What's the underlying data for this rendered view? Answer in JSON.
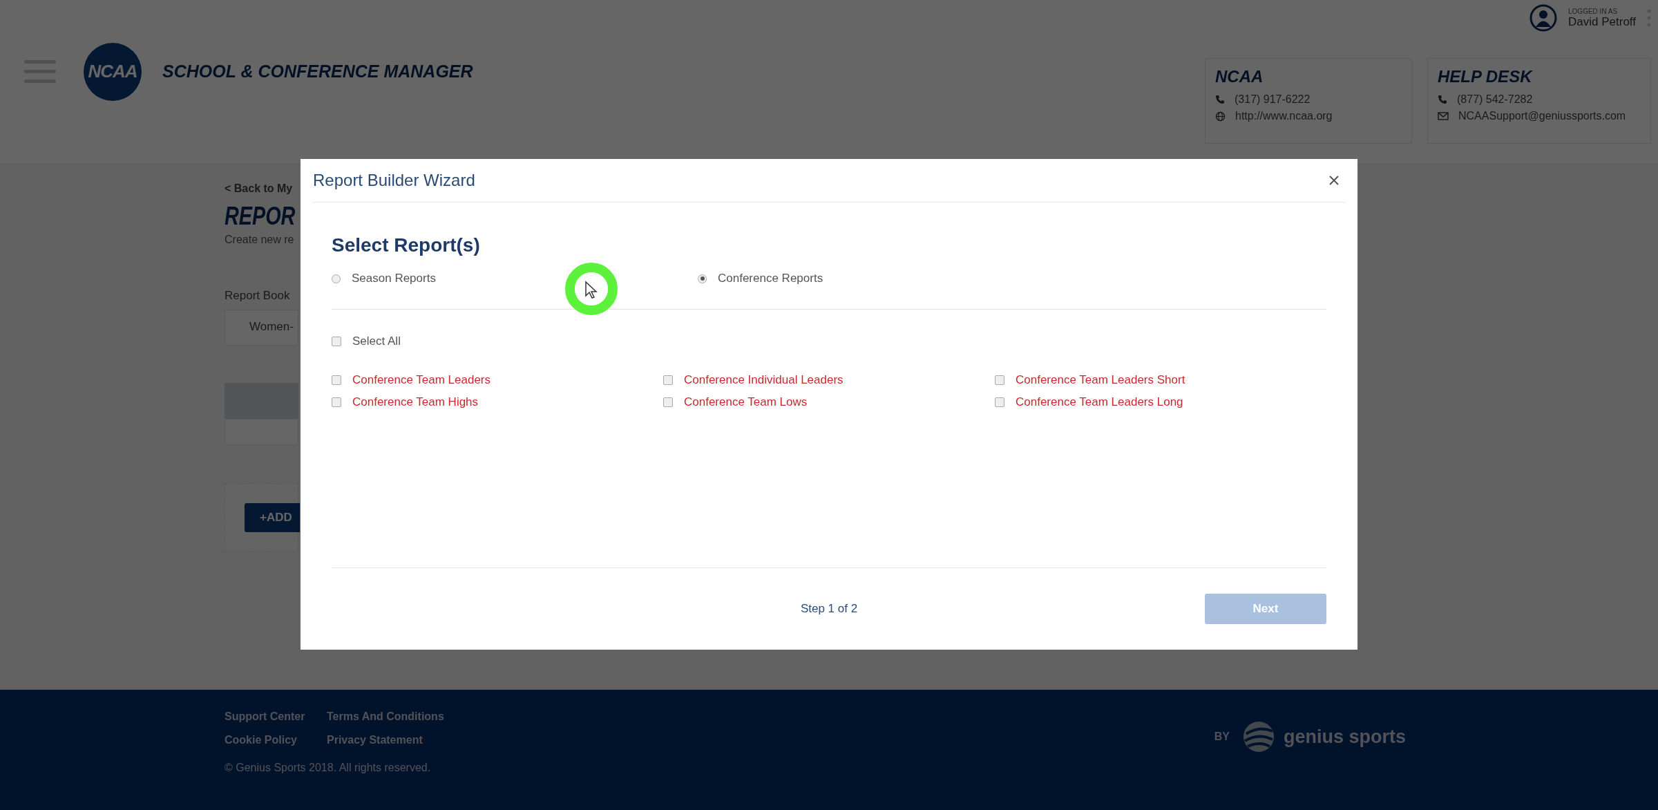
{
  "header": {
    "logo_text": "NCAA",
    "app_title": "SCHOOL & CONFERENCE MANAGER",
    "user": {
      "caption": "LOGGED IN AS",
      "name": "David Petroff"
    },
    "contact_cards": [
      {
        "title": "NCAA",
        "lines": [
          {
            "kind": "phone",
            "text": "(317) 917-6222"
          },
          {
            "kind": "web",
            "text": "http://www.ncaa.org"
          }
        ]
      },
      {
        "title": "HELP DESK",
        "lines": [
          {
            "kind": "phone",
            "text": "(877) 542-7282"
          },
          {
            "kind": "email",
            "text": "NCAASupport@geniussports.com"
          }
        ]
      }
    ]
  },
  "page": {
    "back_link": "< Back to My",
    "title": "REPOR",
    "subtitle": "Create new re",
    "report_book_label": "Report Book",
    "report_book_value": "Women-",
    "add_button": "+ADD"
  },
  "modal": {
    "title": "Report Builder Wizard",
    "heading": "Select Report(s)",
    "report_types": [
      {
        "label": "Season Reports",
        "selected": false
      },
      {
        "label": "Conference Reports",
        "selected": true
      }
    ],
    "select_all": {
      "label": "Select All",
      "checked": false
    },
    "reports": [
      {
        "label": "Conference Team Leaders",
        "checked": false
      },
      {
        "label": "Conference Individual Leaders",
        "checked": false
      },
      {
        "label": "Conference Team Leaders Short",
        "checked": false
      },
      {
        "label": "Conference Team Highs",
        "checked": false
      },
      {
        "label": "Conference Team Lows",
        "checked": false
      },
      {
        "label": "Conference Team Leaders Long",
        "checked": false
      }
    ],
    "step": "Step 1 of 2",
    "next_button": {
      "label": "Next",
      "disabled": true
    }
  },
  "footer": {
    "links": [
      "Support Center",
      "Terms And Conditions",
      "Cookie Policy",
      "Privacy Statement"
    ],
    "copyright": "© Genius Sports 2018. All rights reserved.",
    "brand": {
      "prefix": "BY",
      "name": "genius sports"
    }
  }
}
